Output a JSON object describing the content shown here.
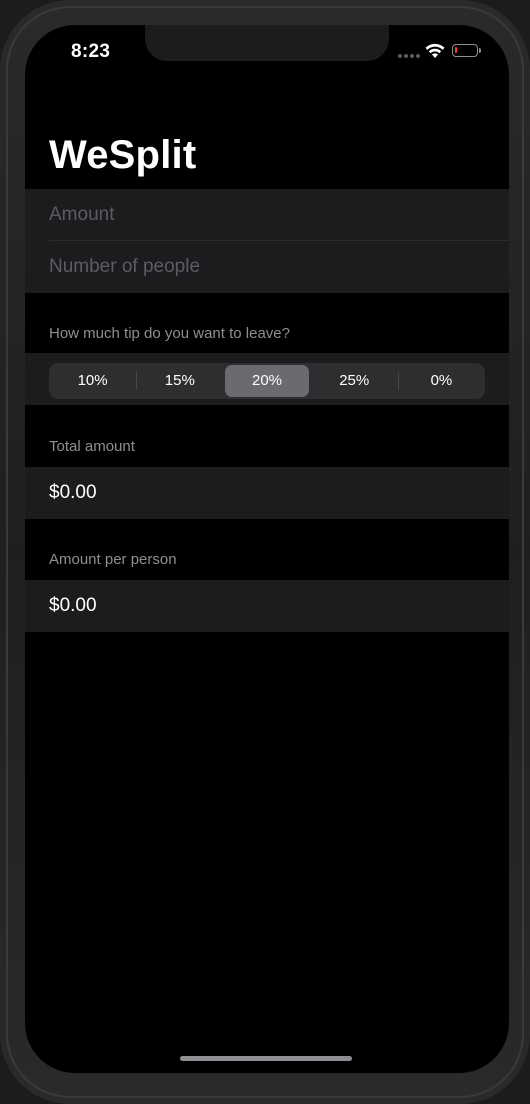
{
  "status_bar": {
    "time": "8:23",
    "battery_level_percent": 10,
    "battery_color": "#ff3b30"
  },
  "app": {
    "title": "WeSplit"
  },
  "form": {
    "amount_placeholder": "Amount",
    "people_placeholder": "Number of people"
  },
  "tip_section": {
    "header": "How much tip do you want to leave?",
    "options": [
      "10%",
      "15%",
      "20%",
      "25%",
      "0%"
    ],
    "selected": "20%"
  },
  "total_section": {
    "header": "Total amount",
    "value": "$0.00"
  },
  "per_person_section": {
    "header": "Amount per person",
    "value": "$0.00"
  },
  "colors": {
    "background": "#000000",
    "cell_background": "#1c1c1e",
    "segment_selected": "#6a6a6f"
  },
  "icons": [
    "cellular-signal-icon",
    "wifi-icon",
    "battery-icon"
  ]
}
